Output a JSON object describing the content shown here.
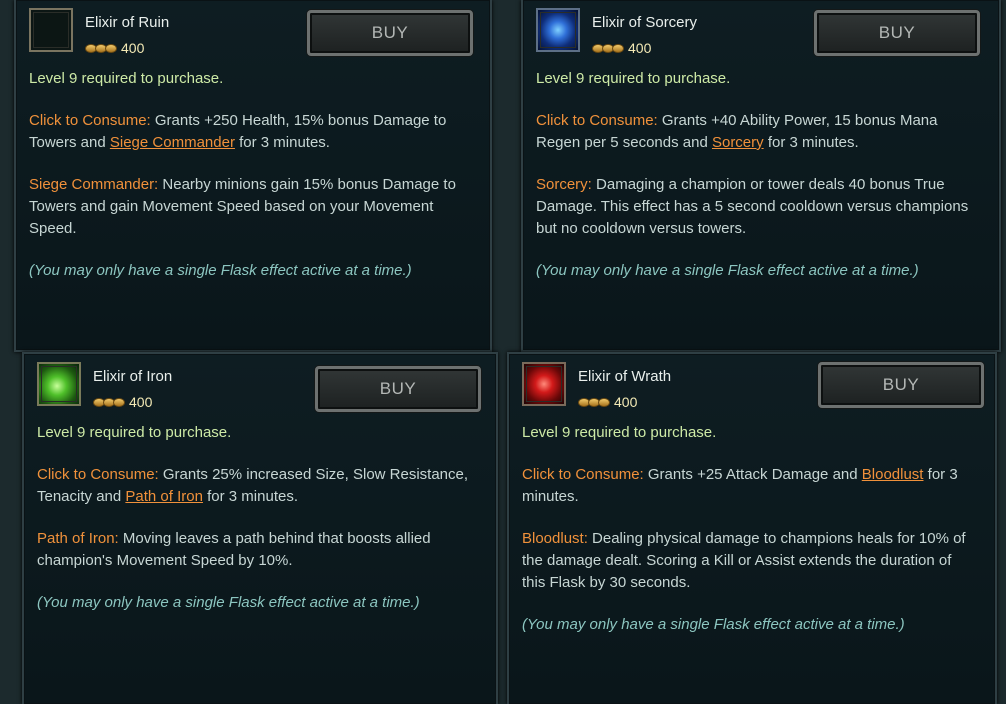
{
  "cards": {
    "ruin": {
      "title": "Elixir of Ruin",
      "icon": "elixir-of-ruin-icon",
      "price": "400",
      "buy_label": "BUY",
      "requirement": "Level 9 required to purchase.",
      "consume_label": "Click to Consume:",
      "consume_pre": " Grants +250 Health, 15% bonus Damage to Towers and ",
      "consume_link": "Siege Commander",
      "consume_post": " for 3 minutes.",
      "passive_label": "Siege Commander:",
      "passive_text": " Nearby minions gain 15% bonus Damage to Towers and gain Movement Speed based on your Movement Speed.",
      "note": "(You may only have a single Flask effect active at a time.)"
    },
    "sorcery": {
      "title": "Elixir of Sorcery",
      "icon": "elixir-of-sorcery-icon",
      "price": "400",
      "buy_label": "BUY",
      "requirement": "Level 9 required to purchase.",
      "consume_label": "Click to Consume:",
      "consume_pre": " Grants +40 Ability Power, 15 bonus Mana Regen per 5 seconds and ",
      "consume_link": "Sorcery",
      "consume_post": " for 3 minutes.",
      "passive_label": "Sorcery:",
      "passive_text": " Damaging a champion or tower deals 40 bonus True Damage. This effect has a 5 second cooldown versus champions but no cooldown versus towers.",
      "note": "(You may only have a single Flask effect active at a time.)"
    },
    "iron": {
      "title": "Elixir of Iron",
      "icon": "elixir-of-iron-icon",
      "price": "400",
      "buy_label": "BUY",
      "requirement": "Level 9 required to purchase.",
      "consume_label": "Click to Consume:",
      "consume_pre": " Grants 25% increased Size, Slow Resistance, Tenacity and ",
      "consume_link": "Path of Iron",
      "consume_post": " for 3 minutes.",
      "passive_label": "Path of Iron:",
      "passive_text": " Moving leaves a path behind that boosts allied champion's Movement Speed by 10%.",
      "note": "(You may only have a single Flask effect active at a time.)"
    },
    "wrath": {
      "title": "Elixir of Wrath",
      "icon": "elixir-of-wrath-icon",
      "price": "400",
      "buy_label": "BUY",
      "requirement": "Level 9 required to purchase.",
      "consume_label": "Click to Consume:",
      "consume_pre": " Grants +25 Attack Damage and ",
      "consume_link": "Bloodlust",
      "consume_post": " for 3 minutes.",
      "passive_label": "Bloodlust:",
      "passive_text": " Dealing physical damage to champions heals for 10% of the damage dealt. Scoring a Kill or Assist extends the duration of this Flask by 30 seconds.",
      "note": "(You may only have a single Flask effect active at a time.)"
    }
  },
  "colors": {
    "keyword": "#f0913b",
    "requirement": "#cdeaa6",
    "note": "#8cc6c0",
    "gold": "#f3e9b5"
  }
}
